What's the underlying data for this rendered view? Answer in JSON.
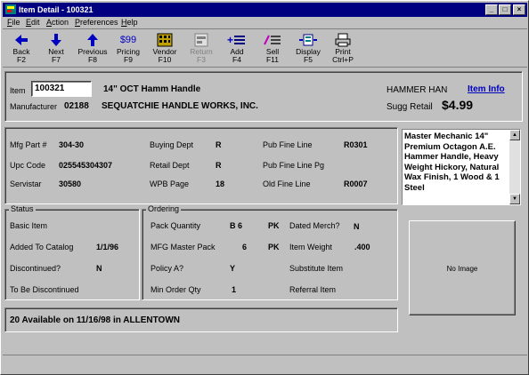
{
  "window": {
    "title": "Item Detail - 100321"
  },
  "menu": [
    {
      "label": "File",
      "u": "F",
      "rest": "ile"
    },
    {
      "label": "Edit",
      "u": "E",
      "rest": "dit"
    },
    {
      "label": "Action",
      "u": "A",
      "rest": "ction"
    },
    {
      "label": "Preferences",
      "u": "P",
      "rest": "references"
    },
    {
      "label": "Help",
      "u": "H",
      "rest": "elp"
    }
  ],
  "toolbar": {
    "back": {
      "label": "Back",
      "key": "F2",
      "icon": "arrow-left-icon"
    },
    "next": {
      "label": "Next",
      "key": "F7",
      "icon": "arrow-down-icon"
    },
    "previous": {
      "label": "Previous",
      "key": "F8",
      "icon": "arrow-up-icon"
    },
    "pricing": {
      "label": "Pricing",
      "key": "F9",
      "icon": "dollar-icon",
      "icon_text": "$99"
    },
    "vendor": {
      "label": "Vendor",
      "key": "F10",
      "icon": "building-icon"
    },
    "return": {
      "label": "Return",
      "key": "F3",
      "icon": "globe-icon",
      "disabled": true
    },
    "add": {
      "label": "Add",
      "key": "F4",
      "icon": "add-icon"
    },
    "sell": {
      "label": "Sell",
      "key": "F11",
      "icon": "sell-icon"
    },
    "display": {
      "label": "Display",
      "key": "F5",
      "icon": "display-icon"
    },
    "print": {
      "label": "Print",
      "key": "Ctrl+P",
      "icon": "printer-icon"
    }
  },
  "header": {
    "item_label": "Item",
    "item_value": "100321",
    "item_name": "14\" OCT Hamm Handle",
    "manufacturer_label": "Manufacturer",
    "manufacturer_code": "02188",
    "manufacturer_name": "SEQUATCHIE HANDLE WORKS, INC.",
    "short_name": "HAMMER HAN",
    "item_info_link": "Item Info",
    "sugg_retail_label": "Sugg Retail",
    "sugg_retail_value": "$4.99"
  },
  "details": {
    "mfg_part_label": "Mfg Part #",
    "mfg_part_value": "304-30",
    "upc_label": "Upc Code",
    "upc_value": "025545304307",
    "servistar_label": "Servistar",
    "servistar_value": "30580",
    "buying_dept_label": "Buying Dept",
    "buying_dept_value": "R",
    "retail_dept_label": "Retail Dept",
    "retail_dept_value": "R",
    "wpb_page_label": "WPB Page",
    "wpb_page_value": "18",
    "pub_fine_line_label": "Pub Fine Line",
    "pub_fine_line_value": "R0301",
    "pub_fine_line_pg_label": "Pub Fine Line Pg",
    "pub_fine_line_pg_value": "",
    "old_fine_line_label": "Old Fine Line",
    "old_fine_line_value": "R0007"
  },
  "description": "Master Mechanic 14\" Premium Octagon A.E. Hammer Handle, Heavy Weight Hickory, Natural Wax Finish, 1 Wood & 1 Steel",
  "status": {
    "legend": "Status",
    "basic_item_label": "Basic Item",
    "added_label": "Added To Catalog",
    "added_value": "1/1/96",
    "discontinued_label": "Discontinued?",
    "discontinued_value": "N",
    "to_be_disc_label": "To Be Discontinued"
  },
  "ordering": {
    "legend": "Ordering",
    "pack_qty_label": "Pack Quantity",
    "pack_qty_value": "B 6",
    "pack_qty_unit": "PK",
    "mfg_master_label": "MFG Master Pack",
    "mfg_master_value": "6",
    "mfg_master_unit": "PK",
    "policy_label": "Policy A?",
    "policy_value": "Y",
    "min_order_label": "Min Order Qty",
    "min_order_value": "1",
    "dated_label": "Dated Merch?",
    "dated_value": "N",
    "weight_label": "Item Weight",
    "weight_value": ".400",
    "substitute_label": "Substitute Item",
    "referral_label": "Referral Item"
  },
  "image_placeholder": "No Image",
  "availability": "20 Available on 11/16/98 in ALLENTOWN"
}
